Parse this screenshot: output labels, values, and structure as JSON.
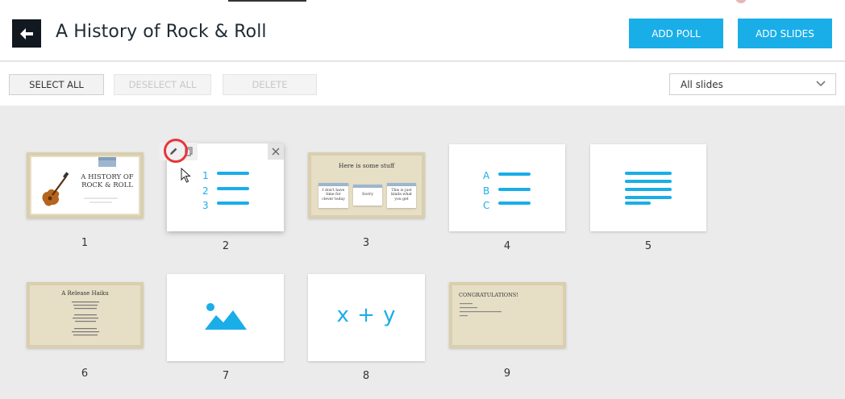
{
  "header": {
    "title": "A History of Rock & Roll",
    "add_poll_label": "ADD POLL",
    "add_slides_label": "ADD SLIDES"
  },
  "toolbar": {
    "select_all_label": "SELECT ALL",
    "deselect_all_label": "DESELECT ALL",
    "delete_label": "DELETE",
    "filter_value": "All slides"
  },
  "slides": [
    {
      "number": "1",
      "title_line1": "A HISTORY OF",
      "title_line2": "ROCK & ROLL"
    },
    {
      "number": "2",
      "list_markers": [
        "1",
        "2",
        "3"
      ]
    },
    {
      "number": "3",
      "title": "Here is some stuff",
      "cards": [
        "I don't have time for clever today",
        "Sorry",
        "This is just kinda what you get"
      ]
    },
    {
      "number": "4",
      "list_markers": [
        "A",
        "B",
        "C"
      ]
    },
    {
      "number": "5"
    },
    {
      "number": "6",
      "title": "A Release Haiku"
    },
    {
      "number": "7"
    },
    {
      "number": "8",
      "formula": "x + y"
    },
    {
      "number": "9",
      "title": "CONGRATULATIONS!"
    }
  ],
  "colors": {
    "accent": "#1aaee8",
    "header_dark": "#111820",
    "highlight_ring": "#e8353b",
    "beige": "#e6dec5"
  },
  "icons": {
    "back": "arrow-left-icon",
    "edit": "pencil-icon",
    "copy": "copy-icon",
    "close": "close-icon",
    "dropdown": "chevron-down-icon",
    "image": "image-icon",
    "cursor": "mouse-pointer-icon"
  }
}
